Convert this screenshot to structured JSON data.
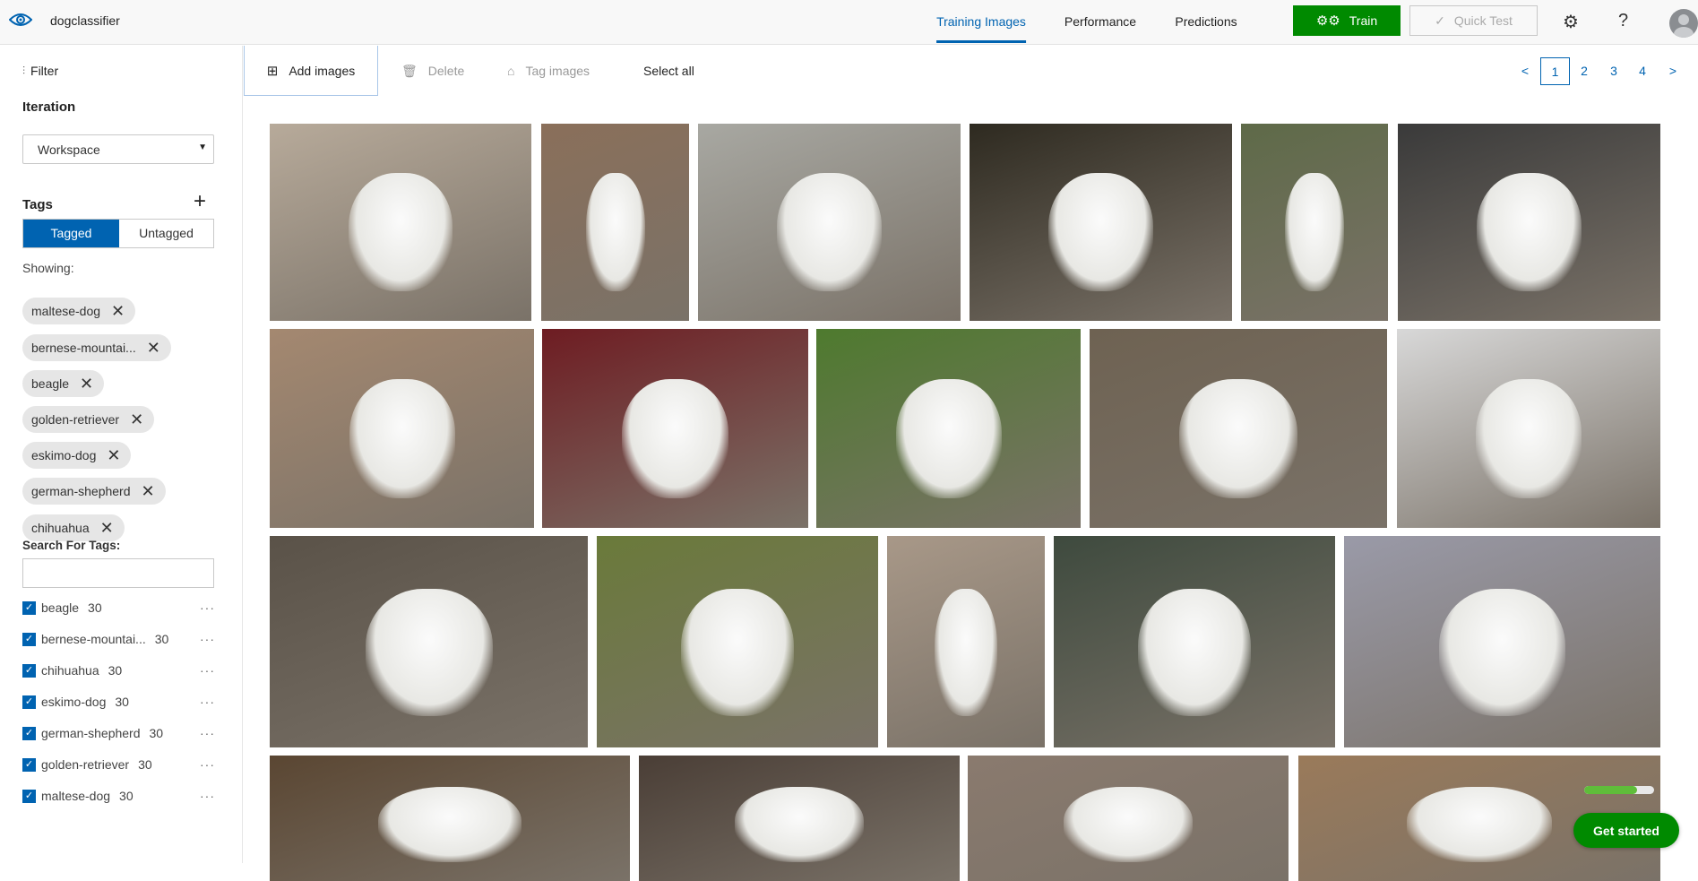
{
  "header": {
    "app_name": "dogclassifier",
    "tabs": [
      {
        "label": "Training Images",
        "active": true
      },
      {
        "label": "Performance"
      },
      {
        "label": "Predictions"
      }
    ],
    "train_label": "Train",
    "quick_test_label": "Quick Test",
    "help_label": "?",
    "accent": "#0063b1",
    "train_color": "#008a00"
  },
  "sidebar": {
    "filter_label": "Filter",
    "iteration_label": "Iteration",
    "iteration_value": "Workspace",
    "tags_label": "Tags",
    "toggle": {
      "tagged": "Tagged",
      "untagged": "Untagged",
      "selected": "Tagged"
    },
    "showing_label": "Showing:",
    "chips": [
      "maltese-dog",
      "bernese-mountai...",
      "beagle",
      "golden-retriever",
      "eskimo-dog",
      "german-shepherd",
      "chihuahua"
    ],
    "search_label": "Search For Tags:",
    "search_value": "",
    "tag_list": [
      {
        "name": "beagle",
        "count": "30",
        "checked": true
      },
      {
        "name": "bernese-mountai...",
        "count": "30",
        "checked": true
      },
      {
        "name": "chihuahua",
        "count": "30",
        "checked": true
      },
      {
        "name": "eskimo-dog",
        "count": "30",
        "checked": true
      },
      {
        "name": "german-shepherd",
        "count": "30",
        "checked": true
      },
      {
        "name": "golden-retriever",
        "count": "30",
        "checked": true
      },
      {
        "name": "maltese-dog",
        "count": "30",
        "checked": true
      }
    ]
  },
  "toolbar": {
    "add_images": "Add images",
    "delete": "Delete",
    "tag_images": "Tag images",
    "select_all": "Select all"
  },
  "pagination": {
    "prev": "<",
    "pages": [
      "1",
      "2",
      "3",
      "4"
    ],
    "current": "1",
    "next": ">"
  },
  "gallery": {
    "image_count_visible": 25
  },
  "get_started": {
    "label": "Get started",
    "progress": 0.75
  }
}
